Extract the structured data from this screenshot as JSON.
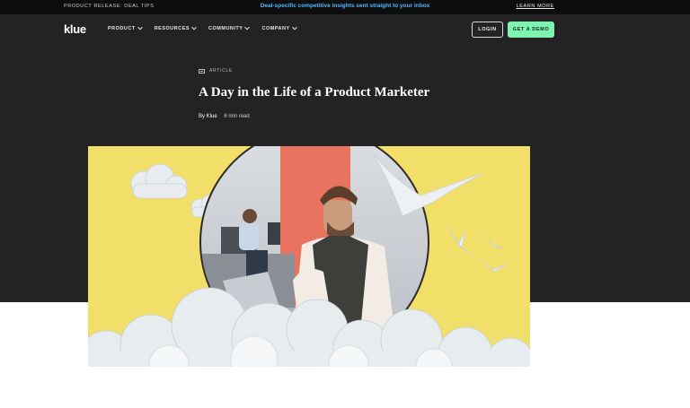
{
  "announcement": {
    "left_text": "PRODUCT RELEASE: DEAL TIPS",
    "center_text": "Deal-specific competitive insights sent straight to your inbox",
    "right_link": "LEARN MORE"
  },
  "nav": {
    "logo": "klue",
    "menu": [
      {
        "label": "PRODUCT"
      },
      {
        "label": "RESOURCES"
      },
      {
        "label": "COMMUNITY"
      },
      {
        "label": "COMPANY"
      }
    ],
    "login_label": "LOGIN",
    "demo_label": "GET A DEMO"
  },
  "article": {
    "tag": "ARTICLE",
    "tag_icon": "article-icon",
    "title": "A Day in the Life of a Product Marketer",
    "author": "By Klue",
    "read_time": "6 min read"
  },
  "colors": {
    "announcement_bg": "#0d0d0d",
    "announcement_accent": "#4fb8ff",
    "hero_bg": "#232323",
    "demo_button": "#7ff3b0",
    "feature_bg": "#f2df6a",
    "feature_circle": "#e8735e"
  }
}
